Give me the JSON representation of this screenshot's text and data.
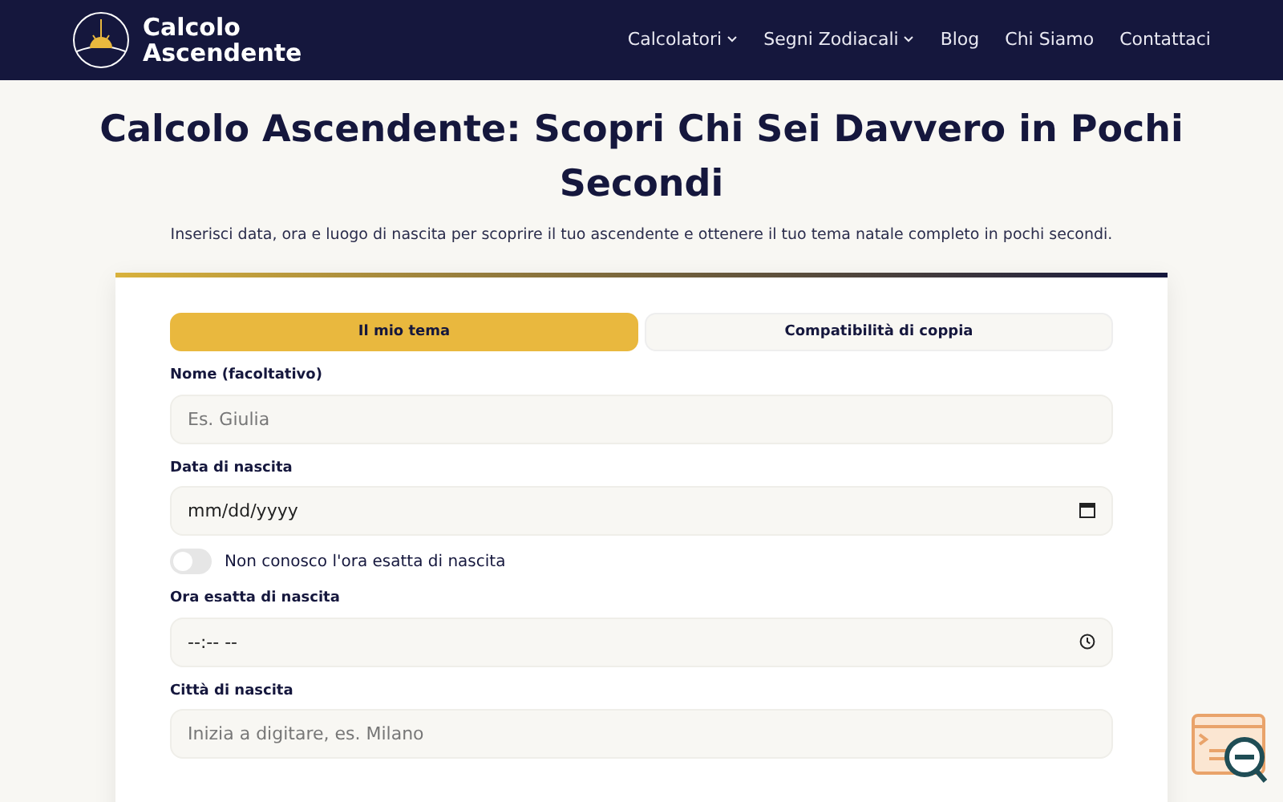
{
  "navbar": {
    "brand_line_1": "Calcolo",
    "brand_line_2": "Ascendente",
    "links": [
      {
        "label": "Calcolatori",
        "dropdown": true
      },
      {
        "label": "Segni Zodiacali",
        "dropdown": true
      },
      {
        "label": "Blog",
        "dropdown": false
      },
      {
        "label": "Chi Siamo",
        "dropdown": false
      },
      {
        "label": "Contattaci",
        "dropdown": false
      }
    ]
  },
  "hero": {
    "title": "Calcolo Ascendente: Scopri Chi Sei Davvero in Pochi Secondi",
    "subtitle": "Inserisci data, ora e luogo di nascita per scoprire il tuo ascendente e ottenere il tuo tema natale completo in pochi secondi."
  },
  "form": {
    "tabs": [
      {
        "label": "Il mio tema",
        "selected": true
      },
      {
        "label": "Compatibilità di coppia",
        "selected": false
      }
    ],
    "fields": [
      {
        "kind": "text",
        "label": "Nome (facoltativo)",
        "placeholder": "Es. Giulia"
      },
      {
        "kind": "date",
        "label": "Data di nascita",
        "placeholder": "mm/dd/yyyy"
      },
      {
        "kind": "toggle",
        "label": "Non conosco l'ora esatta di nascita",
        "on": false
      },
      {
        "kind": "time",
        "label": "Ora esatta di nascita",
        "placeholder": "--:-- --"
      },
      {
        "kind": "text",
        "label": "Città di nascita",
        "placeholder": "Inizia a digitare, es. Milano"
      }
    ]
  }
}
